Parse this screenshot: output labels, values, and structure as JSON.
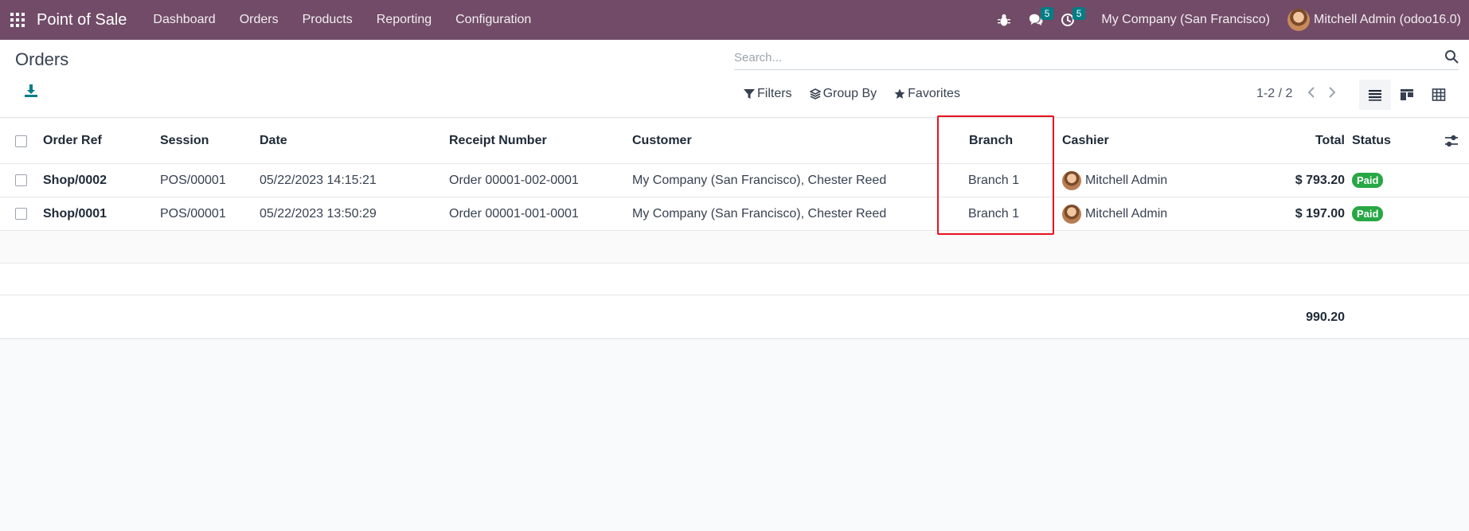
{
  "navbar": {
    "app_name": "Point of Sale",
    "menu": [
      "Dashboard",
      "Orders",
      "Products",
      "Reporting",
      "Configuration"
    ],
    "messages_count": "5",
    "activities_count": "5",
    "company": "My Company (San Francisco)",
    "user": "Mitchell Admin (odoo16.0)",
    "bg_color": "#714b67",
    "badge_color": "#017e84"
  },
  "control": {
    "title": "Orders",
    "search_placeholder": "Search...",
    "filters_label": "Filters",
    "group_by_label": "Group By",
    "favorites_label": "Favorites",
    "pager": "1-2 / 2"
  },
  "table": {
    "columns": {
      "order_ref": "Order Ref",
      "session": "Session",
      "date": "Date",
      "receipt": "Receipt Number",
      "customer": "Customer",
      "branch": "Branch",
      "cashier": "Cashier",
      "total": "Total",
      "status": "Status"
    },
    "rows": [
      {
        "order_ref": "Shop/0002",
        "session": "POS/00001",
        "date": "05/22/2023 14:15:21",
        "receipt": "Order 00001-002-0001",
        "customer": "My Company (San Francisco), Chester Reed",
        "branch": "Branch 1",
        "cashier": "Mitchell Admin",
        "total": "$ 793.20",
        "status": "Paid"
      },
      {
        "order_ref": "Shop/0001",
        "session": "POS/00001",
        "date": "05/22/2023 13:50:29",
        "receipt": "Order 00001-001-0001",
        "customer": "My Company (San Francisco), Chester Reed",
        "branch": "Branch 1",
        "cashier": "Mitchell Admin",
        "total": "$ 197.00",
        "status": "Paid"
      }
    ],
    "sum_total": "990.20",
    "status_color": "#28a745",
    "highlight_color": "#e8121e"
  }
}
